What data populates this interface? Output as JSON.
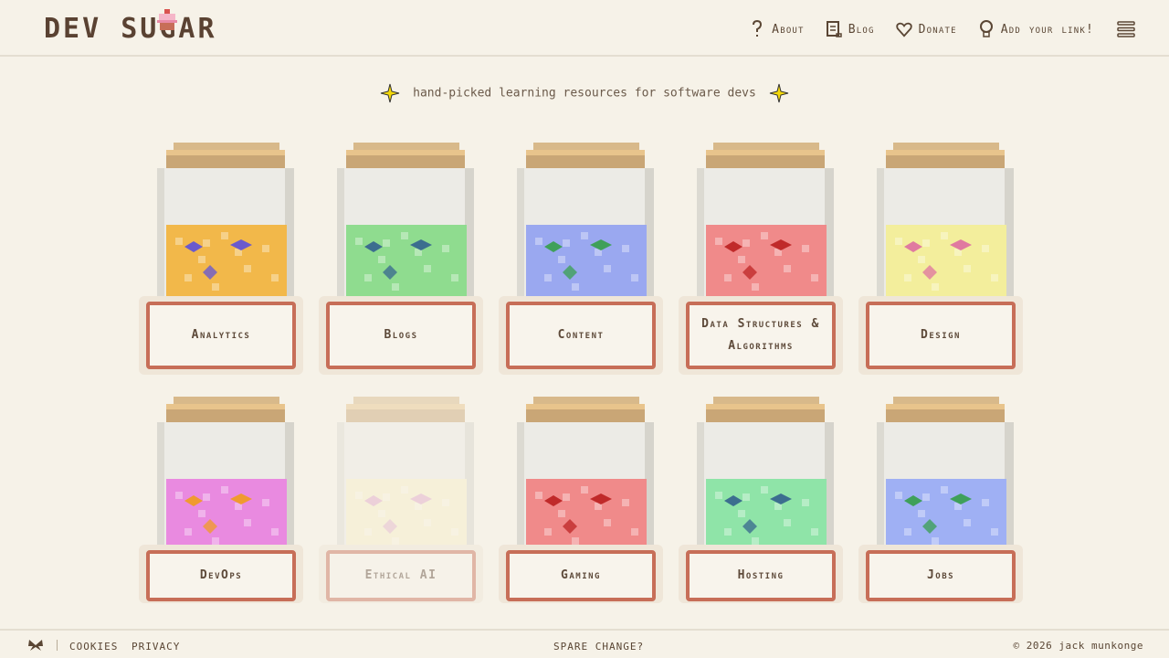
{
  "header": {
    "logo": "DEV SUGAR",
    "nav": [
      {
        "label": "About",
        "icon": "question-icon"
      },
      {
        "label": "Blog",
        "icon": "scroll-icon"
      },
      {
        "label": "Donate",
        "icon": "heart-icon"
      },
      {
        "label": "Add your link!",
        "icon": "lightbulb-icon"
      }
    ],
    "menu_icon": "hamburger-menu-icon"
  },
  "tagline": "hand-picked learning resources for software devs",
  "jars": [
    {
      "label": "Analytics",
      "color": "#f2b84a",
      "candy": "#6a5acd"
    },
    {
      "label": "Blogs",
      "color": "#8fdc8f",
      "candy": "#3c6e8f"
    },
    {
      "label": "Content",
      "color": "#9aa8f0",
      "candy": "#3fa05a"
    },
    {
      "label": "Data Structures & Algorithms",
      "color": "#f08a8a",
      "candy": "#c02a2a"
    },
    {
      "label": "Design",
      "color": "#f3ee9c",
      "candy": "#e07aa0"
    },
    {
      "label": "DevOps",
      "color": "#e98ae0",
      "candy": "#f09a30"
    },
    {
      "label": "Ethical AI",
      "color": "#f6eec8",
      "candy": "#e0a8c8",
      "faded": true
    },
    {
      "label": "Gaming",
      "color": "#f08a8a",
      "candy": "#c02a2a"
    },
    {
      "label": "Hosting",
      "color": "#8fe4a8",
      "candy": "#3c6e8f"
    },
    {
      "label": "Jobs",
      "color": "#9fb0f4",
      "candy": "#3fa05a"
    }
  ],
  "footer": {
    "cookies": "cookies",
    "privacy": "privacy",
    "spare": "spare change?",
    "copyright": "© 2026 jack munkonge"
  }
}
